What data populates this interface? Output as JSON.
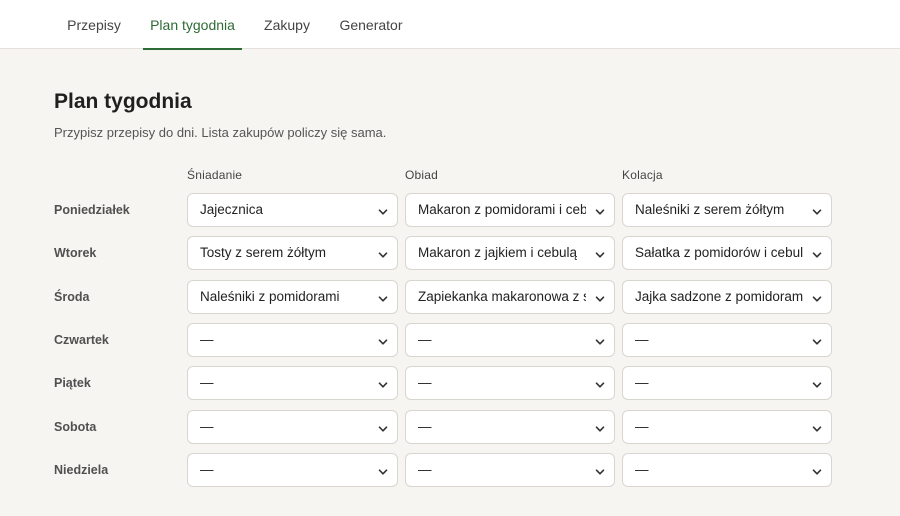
{
  "nav": {
    "tabs": [
      {
        "label": "Przepisy"
      },
      {
        "label": "Plan tygodnia"
      },
      {
        "label": "Zakupy"
      },
      {
        "label": "Generator"
      }
    ],
    "active": "Plan tygodnia"
  },
  "page": {
    "title": "Plan tygodnia",
    "subtitle": "Przypisz przepisy do dni. Lista zakupów policzy się sama."
  },
  "columns": [
    "Śniadanie",
    "Obiad",
    "Kolacja"
  ],
  "rows": [
    {
      "day": "Poniedziałek",
      "meals": [
        "Jajecznica",
        "Makaron z pomidorami i cebulą",
        "Naleśniki z serem żółtym"
      ]
    },
    {
      "day": "Wtorek",
      "meals": [
        "Tosty z serem żółtym",
        "Makaron z jajkiem i cebulą",
        "Sałatka z pomidorów i cebuli"
      ]
    },
    {
      "day": "Środa",
      "meals": [
        "Naleśniki z pomidorami",
        "Zapiekanka makaronowa z serem",
        "Jajka sadzone z pomidorami"
      ]
    },
    {
      "day": "Czwartek",
      "meals": [
        "—",
        "—",
        "—"
      ]
    },
    {
      "day": "Piątek",
      "meals": [
        "—",
        "—",
        "—"
      ]
    },
    {
      "day": "Sobota",
      "meals": [
        "—",
        "—",
        "—"
      ]
    },
    {
      "day": "Niedziela",
      "meals": [
        "—",
        "—",
        "—"
      ]
    }
  ],
  "icons": {
    "dropdown": "chevron-down-icon"
  },
  "colors": {
    "accent": "#2e6b34",
    "background": "#f7f5f1"
  }
}
